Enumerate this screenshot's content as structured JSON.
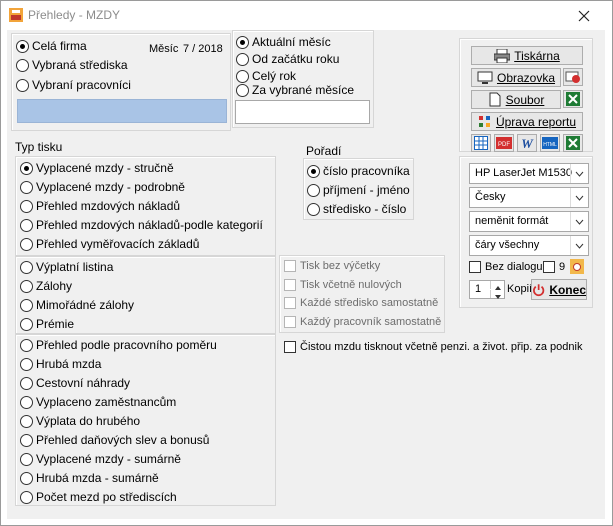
{
  "window": {
    "title": "Přehledy - MZDY"
  },
  "scope": {
    "options": [
      "Celá firma",
      "Vybraná střediska",
      "Vybraní pracovníci"
    ],
    "selected_index": 0
  },
  "month": {
    "label": "Měsíc",
    "value": "7 / 2018"
  },
  "period": {
    "options": [
      "Aktuální měsíc",
      "Od začátku roku",
      "Celý rok",
      "Za vybrané měsíce"
    ],
    "selected_index": 0,
    "months_input_value": ""
  },
  "print_type": {
    "heading": "Typ tisku",
    "selected_index": 0,
    "group1": [
      "Vyplacené mzdy - stručně",
      "Vyplacené mzdy - podrobně",
      "Přehled mzdových nákladů",
      "Přehled mzdových nákladů-podle kategorií",
      "Přehled vyměřovacích základů"
    ],
    "group2": [
      "Výplatní listina",
      "Zálohy",
      "Mimořádné zálohy",
      "Prémie"
    ],
    "group3": [
      "Přehled podle pracovního poměru",
      "Hrubá mzda",
      "Cestovní náhrady",
      "Vyplaceno zaměstnancům",
      "Výplata do hrubého",
      "Přehled daňových slev a bonusů",
      "Vyplacené mzdy - sumárně",
      "Hrubá mzda - sumárně",
      "Počet mezd po střediscích"
    ]
  },
  "order": {
    "heading": "Pořadí",
    "options": [
      "číslo pracovníka",
      "příjmení - jméno",
      "středisko - číslo"
    ],
    "selected_index": 0
  },
  "print_options": [
    "Tisk bez výčetky",
    "Tisk včetně nulových",
    "Každé středisko samostatně",
    "Každý pracovník samostatně"
  ],
  "net_wage_option": "Čistou mzdu tisknout včetně penzi. a život. přip. za podnik",
  "output": {
    "printer_label": "Tiskárna",
    "screen_label": "Obrazovka",
    "file_label": "Soubor",
    "report_edit_label": "Úprava reportu",
    "export_icons": [
      "table-icon",
      "pdf-icon",
      "word-icon",
      "html-icon",
      "excel-icon"
    ]
  },
  "settings": {
    "printer": "HP LaserJet M1530",
    "language": "Česky",
    "format": "neměnit formát",
    "lines": "čáry všechny",
    "no_dialog_label": "Bez dialogu",
    "no_dialog_value": "9",
    "copies_value": "1",
    "copies_label": "Kopií",
    "end_label": "Konec"
  },
  "colors": {
    "accent_excel": "#1e7b34",
    "close_red": "#d32f2f",
    "selection_blue": "#a9c4e6"
  }
}
